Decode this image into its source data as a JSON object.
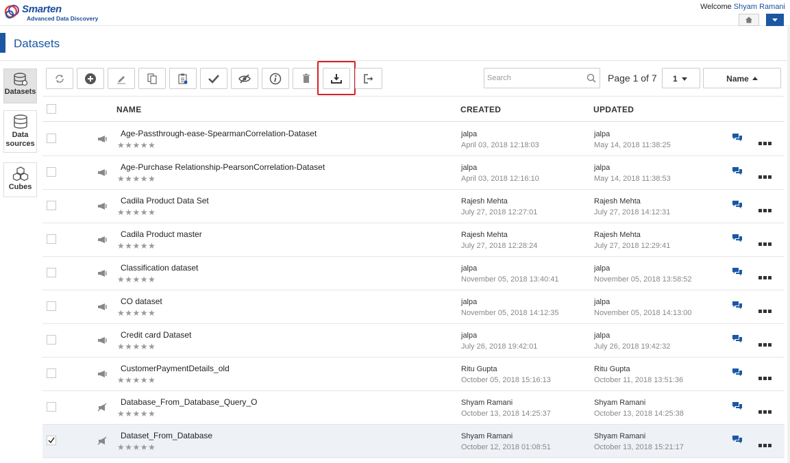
{
  "header": {
    "logo_name": "Smarten",
    "logo_subtitle": "Advanced Data Discovery",
    "welcome_prefix": "Welcome",
    "user_name": "Shyam Ramani",
    "home_icon": "home-icon",
    "menu_icon": "chevron-down-icon"
  },
  "page": {
    "title": "Datasets"
  },
  "sidebar": {
    "items": [
      {
        "label": "Datasets",
        "icon": "datasets-icon",
        "active": true
      },
      {
        "label1": "Data",
        "label2": "sources",
        "icon": "database-icon"
      },
      {
        "label": "Cubes",
        "icon": "cubes-icon"
      }
    ]
  },
  "toolbar": {
    "buttons": [
      "refresh-icon",
      "add-icon",
      "edit-icon",
      "copy-icon",
      "paste-icon",
      "check-icon",
      "hide-icon",
      "info-icon",
      "delete-icon",
      "download-icon",
      "export-icon"
    ],
    "search_placeholder": "Search",
    "page_label": "Page 1 of 7",
    "page_select": "1",
    "sort_label": "Name"
  },
  "table": {
    "columns": {
      "name": "NAME",
      "created": "CREATED",
      "updated": "UPDATED"
    },
    "rows": [
      {
        "name": "Age-Passthrough-ease-SpearmanCorrelation-Dataset",
        "created_by": "jalpa",
        "created_at": "April 03, 2018 12:18:03",
        "updated_by": "jalpa",
        "updated_at": "May 14, 2018 11:38:25",
        "type": "megaphone",
        "checked": false
      },
      {
        "name": "Age-Purchase Relationship-PearsonCorrelation-Dataset",
        "created_by": "jalpa",
        "created_at": "April 03, 2018 12:16:10",
        "updated_by": "jalpa",
        "updated_at": "May 14, 2018 11:38:53",
        "type": "megaphone",
        "checked": false
      },
      {
        "name": "Cadila Product Data Set",
        "created_by": "Rajesh Mehta",
        "created_at": "July 27, 2018 12:27:01",
        "updated_by": "Rajesh Mehta",
        "updated_at": "July 27, 2018 14:12:31",
        "type": "megaphone",
        "checked": false
      },
      {
        "name": "Cadila Product master",
        "created_by": "Rajesh Mehta",
        "created_at": "July 27, 2018 12:28:24",
        "updated_by": "Rajesh Mehta",
        "updated_at": "July 27, 2018 12:29:41",
        "type": "megaphone",
        "checked": false
      },
      {
        "name": "Classification dataset",
        "created_by": "jalpa",
        "created_at": "November 05, 2018 13:40:41",
        "updated_by": "jalpa",
        "updated_at": "November 05, 2018 13:58:52",
        "type": "megaphone",
        "checked": false
      },
      {
        "name": "CO dataset",
        "created_by": "jalpa",
        "created_at": "November 05, 2018 14:12:35",
        "updated_by": "jalpa",
        "updated_at": "November 05, 2018 14:13:00",
        "type": "megaphone",
        "checked": false
      },
      {
        "name": "Credit card Dataset",
        "created_by": "jalpa",
        "created_at": "July 26, 2018 19:42:01",
        "updated_by": "jalpa",
        "updated_at": "July 26, 2018 19:42:32",
        "type": "megaphone",
        "checked": false
      },
      {
        "name": "CustomerPaymentDetails_old",
        "created_by": "Ritu Gupta",
        "created_at": "October 05, 2018 15:16:13",
        "updated_by": "Ritu Gupta",
        "updated_at": "October 11, 2018 13:51:36",
        "type": "megaphone",
        "checked": false
      },
      {
        "name": "Database_From_Database_Query_O",
        "created_by": "Shyam Ramani",
        "created_at": "October 13, 2018 14:25:37",
        "updated_by": "Shyam Ramani",
        "updated_at": "October 13, 2018 14:25:38",
        "type": "mute",
        "checked": false
      },
      {
        "name": "Dataset_From_Database",
        "created_by": "Shyam Ramani",
        "created_at": "October 12, 2018 01:08:51",
        "updated_by": "Shyam Ramani",
        "updated_at": "October 13, 2018 15:21:17",
        "type": "mute",
        "checked": true
      }
    ]
  },
  "colors": {
    "accent": "#1b57a3",
    "highlight": "#d62027"
  }
}
